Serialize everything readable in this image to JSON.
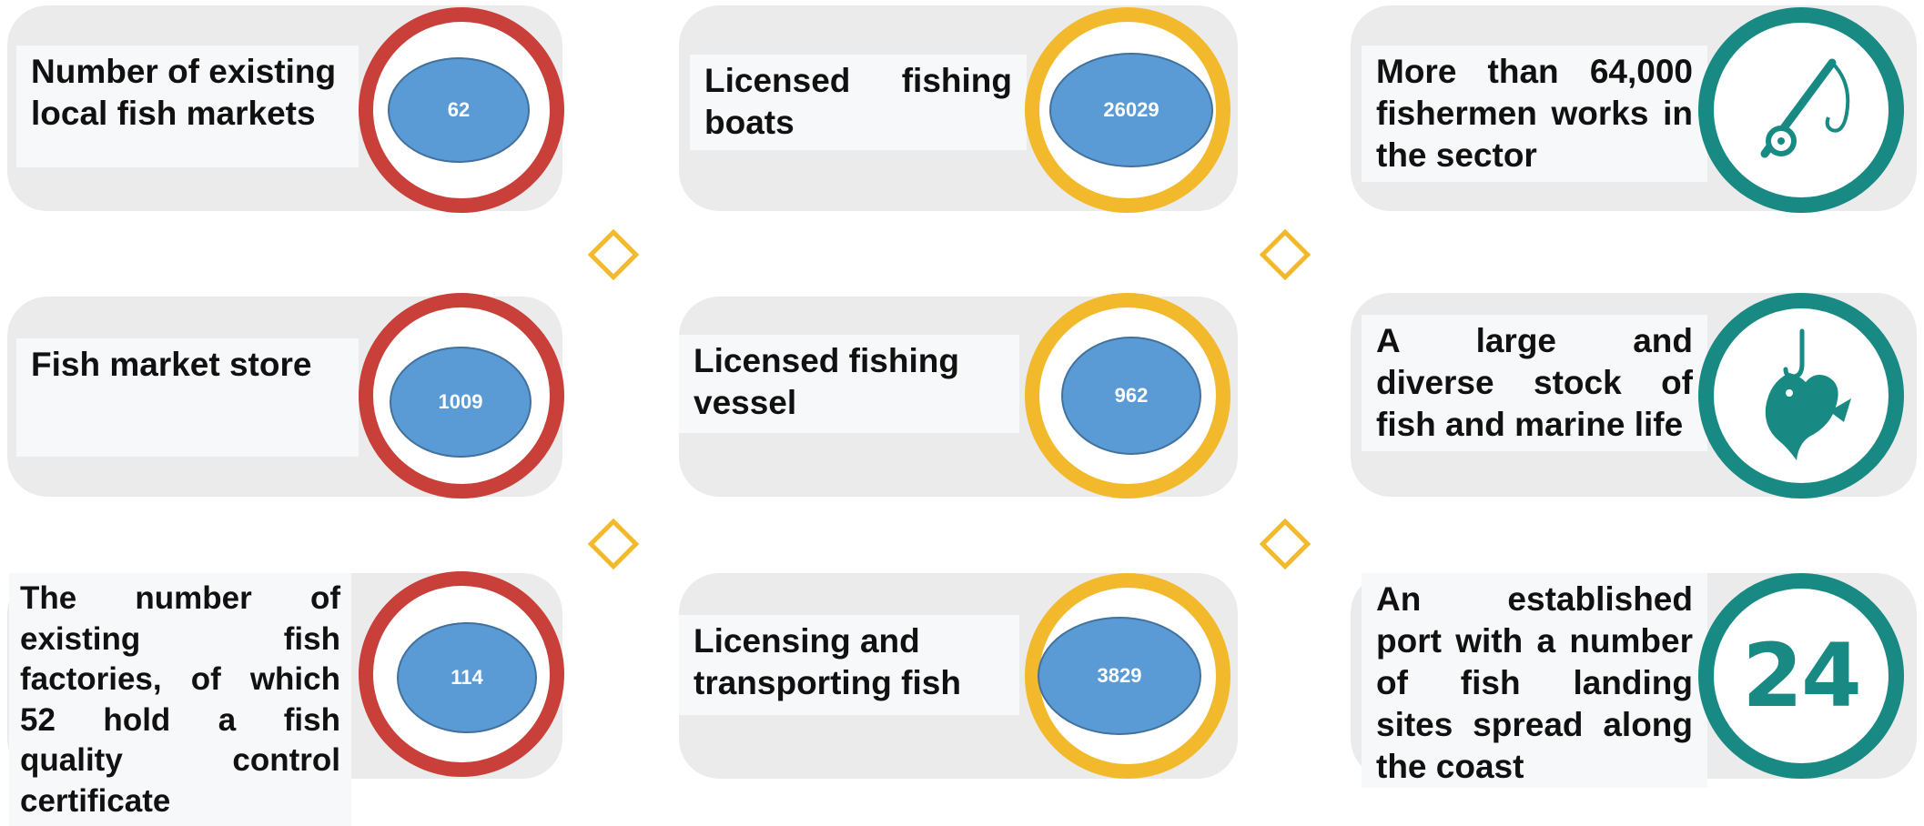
{
  "cards": [
    {
      "label_lines": [
        "Number of existing",
        "local fish markets"
      ],
      "value": "62"
    },
    {
      "label_lines": [
        "Licensed fishing",
        "boats"
      ],
      "value": "26029"
    },
    {
      "label_lines": [
        "More than 64,000",
        "fishermen works in",
        "the sector"
      ],
      "icon": "fishing-rod-icon"
    },
    {
      "label_lines": [
        "Fish market store"
      ],
      "value": "1009"
    },
    {
      "label_lines": [
        "Licensed fishing",
        "vessel"
      ],
      "value": "962"
    },
    {
      "label_lines": [
        "A large and",
        "diverse stock of",
        "fish and marine life"
      ],
      "icon": "fish-on-hook-icon"
    },
    {
      "label_lines": [
        "The number of",
        "existing fish",
        "factories, of which",
        "52 hold a fish",
        "quality control",
        "certificate"
      ],
      "value": "114"
    },
    {
      "label_lines": [
        "Licensing and",
        "transporting fish"
      ],
      "value": "3829"
    },
    {
      "label_lines": [
        "An established",
        "port with a number",
        "of fish landing",
        "sites spread along",
        "the coast"
      ],
      "value": "24"
    }
  ],
  "colors": {
    "red_ring": "#c9403a",
    "yellow_ring": "#f3b92d",
    "teal_ring": "#188a83",
    "value_oval": "#5b9bd5",
    "card_background": "#ebebeb"
  }
}
